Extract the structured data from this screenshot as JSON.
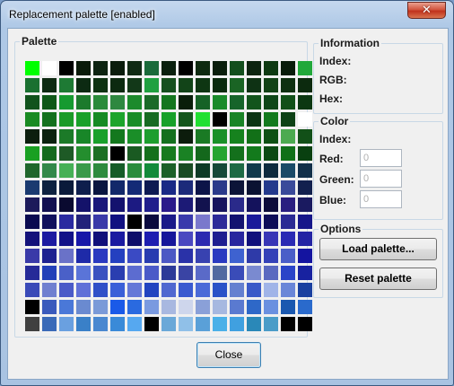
{
  "window": {
    "title": "Replacement palette [enabled]",
    "close_glyph": "✕"
  },
  "palette": {
    "legend": "Palette",
    "colors": [
      "#00ff00",
      "#ffffff",
      "#000000",
      "#0a1a0a",
      "#0e2412",
      "#0a1c0c",
      "#102a14",
      "#1a6a3a",
      "#0a200e",
      "#000000",
      "#0e2a10",
      "#0a1e0c",
      "#134f1d",
      "#0c2410",
      "#0e3a12",
      "#081c0a",
      "#21a83a",
      "#1a7030",
      "#0e2a12",
      "#1e7a34",
      "#0c2a12",
      "#0e3212",
      "#0c2a10",
      "#123818",
      "#1fa040",
      "#164f1e",
      "#124418",
      "#0e3612",
      "#0a2a0e",
      "#1a6424",
      "#0e3214",
      "#124216",
      "#0e3010",
      "#0c2a0e",
      "#11521c",
      "#0f5818",
      "#169a30",
      "#1c7a2c",
      "#2a8a3a",
      "#2e8840",
      "#1c8a2c",
      "#1a6a28",
      "#14761e",
      "#0a1e0a",
      "#166226",
      "#198a2a",
      "#16642a",
      "#12541c",
      "#0e4618",
      "#115018",
      "#0c3812",
      "#1a8a22",
      "#14701e",
      "#1b9a28",
      "#1aa02a",
      "#168a24",
      "#1da42c",
      "#1a8c28",
      "#176a22",
      "#18a02a",
      "#14561c",
      "#21e032",
      "#000000",
      "#1a8426",
      "#0c3414",
      "#137a1e",
      "#0e4216",
      "#ffffff",
      "#0c1e0e",
      "#0c2210",
      "#1c7a28",
      "#188628",
      "#1aa02c",
      "#14781e",
      "#1a8e28",
      "#1d9e2e",
      "#14701e",
      "#0c1c0c",
      "#1a7a24",
      "#1a9028",
      "#16821e",
      "#127018",
      "#0e5014",
      "#4caa50",
      "#125018",
      "#19a022",
      "#156a1e",
      "#1e5a26",
      "#248e2e",
      "#1c7024",
      "#000000",
      "#1a5a22",
      "#14701c",
      "#177a1e",
      "#1a8224",
      "#14681c",
      "#25a430",
      "#14701c",
      "#137a1c",
      "#0c4a14",
      "#107018",
      "#094010",
      "#20662c",
      "#33884a",
      "#46b056",
      "#3a9a4a",
      "#2e8a3e",
      "#165c28",
      "#2a8c3c",
      "#138a3a",
      "#1c6028",
      "#1a4c24",
      "#0e3a26",
      "#164838",
      "#1e6a44",
      "#123a4c",
      "#0e2a3e",
      "#1a4a68",
      "#12304a",
      "#1a3a70",
      "#0e2240",
      "#0a1a3a",
      "#0e1e4c",
      "#0a1640",
      "#12286a",
      "#142a76",
      "#0e1a52",
      "#1a2a86",
      "#1c2a7a",
      "#0c1448",
      "#2a3a8a",
      "#0c1438",
      "#0a1232",
      "#243a8c",
      "#3a4a9a",
      "#12204e",
      "#1c1a5a",
      "#121050",
      "#0a0a30",
      "#14126a",
      "#1a187a",
      "#14126e",
      "#1c1a82",
      "#201e8c",
      "#2a1a8a",
      "#1c1a76",
      "#12124e",
      "#16145e",
      "#2a2a8a",
      "#14125c",
      "#0c0c3a",
      "#2a1e80",
      "#1a1a60",
      "#0a0a50",
      "#10105c",
      "#2a2aa0",
      "#22227a",
      "#3a3aa8",
      "#101080",
      "#000000",
      "#0a0a3e",
      "#1a1a88",
      "#3a3aac",
      "#7a78cc",
      "#2c2a98",
      "#121270",
      "#1a1a9a",
      "#0e0e58",
      "#2a2a94",
      "#16168a",
      "#14127a",
      "#1c1aa0",
      "#121288",
      "#1818a8",
      "#10107a",
      "#1a1aa0",
      "#0e0e6a",
      "#1e1eb0",
      "#16169a",
      "#4a48c0",
      "#2c2ab0",
      "#1e1e90",
      "#28269e",
      "#10107c",
      "#3836b6",
      "#2a2ab4",
      "#2424a4",
      "#3a3aa8",
      "#1e2290",
      "#6a72c8",
      "#1e2aa8",
      "#2a3ac0",
      "#2440c0",
      "#3a4ac4",
      "#283cb0",
      "#4c58c4",
      "#2a32a8",
      "#3842b0",
      "#2a3ac0",
      "#3e62d0",
      "#2e3aa8",
      "#3442b8",
      "#4a5ec8",
      "#1414a0",
      "#262a98",
      "#2240b8",
      "#4a60c8",
      "#5a74d8",
      "#3a52c0",
      "#2a3eb0",
      "#5c6cd0",
      "#4a5ac8",
      "#2c3a98",
      "#3a44a4",
      "#5a6ac8",
      "#526aa0",
      "#3a4cb8",
      "#7a8ad0",
      "#5a6ac0",
      "#2a44c8",
      "#1822a0",
      "#3a4ab8",
      "#7080d0",
      "#4a5ac8",
      "#6070d8",
      "#3050c8",
      "#3a60d8",
      "#6478d8",
      "#2244c0",
      "#5068d0",
      "#3a5ad0",
      "#4a6ad8",
      "#2a52c8",
      "#6480d0",
      "#3a5ac8",
      "#a0b4e8",
      "#6a86d8",
      "#1a40a0",
      "#000000",
      "#3a5abc",
      "#4a78d8",
      "#6a8ad0",
      "#7a9ad8",
      "#1a5ae8",
      "#2a6ae0",
      "#7a9ae0",
      "#a8b8e0",
      "#ced6ec",
      "#8aa0d8",
      "#a6b8e0",
      "#5a7ad0",
      "#2e68c8",
      "#6a90e0",
      "#1a58b0",
      "#2a6acc",
      "#404040",
      "#3a6ab8",
      "#6aa0e0",
      "#3a80c8",
      "#4a88d0",
      "#3a8ad8",
      "#56a8f0",
      "#000000",
      "#6aa8d8",
      "#90c0e8",
      "#5aa0d8",
      "#4ab0e8",
      "#40a0e0",
      "#2a88b8",
      "#4a9cc8",
      "#000000",
      "#000000"
    ]
  },
  "information": {
    "legend": "Information",
    "index_label": "Index:",
    "rgb_label": "RGB:",
    "hex_label": "Hex:"
  },
  "color": {
    "legend": "Color",
    "index_label": "Index:",
    "red_label": "Red:",
    "green_label": "Green:",
    "blue_label": "Blue:",
    "red_placeholder": "0",
    "green_placeholder": "0",
    "blue_placeholder": "0"
  },
  "options": {
    "legend": "Options",
    "load_label": "Load palette...",
    "reset_label": "Reset palette"
  },
  "footer": {
    "close_label": "Close"
  }
}
